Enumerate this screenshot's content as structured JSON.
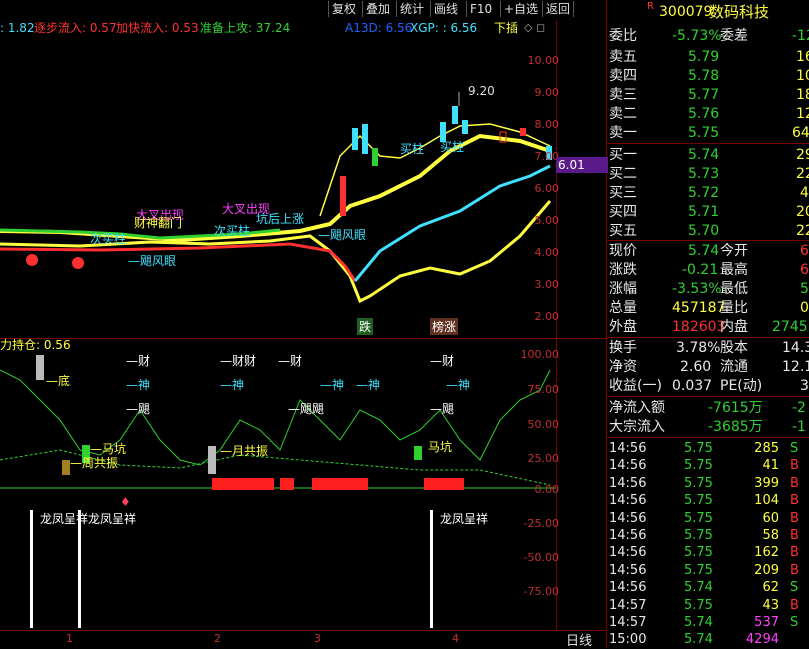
{
  "toolbar": {
    "buttons": [
      "复权",
      "叠加",
      "统计",
      "画线",
      "F10",
      "+自选",
      "返回"
    ]
  },
  "header": {
    "flag": "R",
    "code": "300079",
    "name": "数码科技"
  },
  "indicator_line": {
    "prefix": ": 1.82",
    "zhubu_label": "逐步流入: 0.57",
    "jiakuai_label": "加快流入: 0.53",
    "zhunbei_label": "准备上攻: 37.24",
    "a13d_label": "A13D: 6.56",
    "xgp_label": "XGP: : 6.56",
    "xiacha_label": "下插"
  },
  "upper_axis": [
    "10.00",
    "9.00",
    "8.00",
    "7.00",
    "6.00",
    "5.00",
    "4.00",
    "3.00",
    "2.00",
    "1.00"
  ],
  "price_marker": "6.01",
  "lower_axis": [
    "100.00",
    "75.00",
    "50.00",
    "25.00",
    "0.00",
    "-25.00",
    "-50.00",
    "-75.00"
  ],
  "lower_title": "力持仓: 0.56",
  "x_labels": [
    "1",
    "2",
    "3",
    "4"
  ],
  "period_button": "日线",
  "annotations": {
    "high": "9.20",
    "dachu1": "大叉出现",
    "dachu2": "大叉出现",
    "caishen": "财神翻门",
    "fengyan1": "—飓风眼",
    "fengyan2": "—飓风眼",
    "maizhu1": "次买柱",
    "maizhu2": "次买柱",
    "maizhu3": "买柱",
    "maizhu4": "买柱",
    "kenghou": "坑后上涨",
    "die": "跌",
    "zhang": "榜涨",
    "di": "—底",
    "cai1": "—财",
    "cai2": "—财财",
    "cai3": "—财",
    "cai4": "—财",
    "shen1": "—神",
    "shen2": "—神",
    "shen3": "—神",
    "shen4": "—神",
    "shen5": "—神",
    "hao1": "—飓",
    "hao2": "—飓飓",
    "hao3": "—飓",
    "makeng1": "—马坑",
    "makeng2": "马坑",
    "zhouzhen": "—周共振",
    "yuezhen": "—月共振",
    "longfeng1": "龙凤呈祥龙凤呈祥",
    "longfeng2": "龙凤呈祥"
  },
  "quote": {
    "weibi_label": "委比",
    "weibi_val": "-5.73%",
    "weicha_label": "委差",
    "weicha_val": "-12",
    "sell": [
      {
        "label": "卖五",
        "price": "5.79",
        "vol": "16"
      },
      {
        "label": "卖四",
        "price": "5.78",
        "vol": "10"
      },
      {
        "label": "卖三",
        "price": "5.77",
        "vol": "18"
      },
      {
        "label": "卖二",
        "price": "5.76",
        "vol": "12"
      },
      {
        "label": "卖一",
        "price": "5.75",
        "vol": "64"
      }
    ],
    "buy": [
      {
        "label": "买一",
        "price": "5.74",
        "vol": "29"
      },
      {
        "label": "买二",
        "price": "5.73",
        "vol": "22"
      },
      {
        "label": "买三",
        "price": "5.72",
        "vol": "4"
      },
      {
        "label": "买四",
        "price": "5.71",
        "vol": "20"
      },
      {
        "label": "买五",
        "price": "5.70",
        "vol": "22"
      }
    ],
    "stats": [
      {
        "l1": "现价",
        "v1": "5.74",
        "l2": "今开",
        "v2": "6"
      },
      {
        "l1": "涨跌",
        "v1": "-0.21",
        "l2": "最高",
        "v2": "6"
      },
      {
        "l1": "涨幅",
        "v1": "-3.53%",
        "l2": "最低",
        "v2": "5"
      },
      {
        "l1": "总量",
        "v1": "457187",
        "l2": "量比",
        "v2": "0"
      },
      {
        "l1": "外盘",
        "v1": "182603",
        "l2": "内盘",
        "v2": "2745"
      }
    ],
    "stats2": [
      {
        "l1": "换手",
        "v1": "3.78%",
        "l2": "股本",
        "v2": "14.3"
      },
      {
        "l1": "净资",
        "v1": "2.60",
        "l2": "流通",
        "v2": "12.1"
      },
      {
        "l1": "收益(一)",
        "v1": "0.037",
        "l2": "PE(动)",
        "v2": "3"
      }
    ],
    "flows": [
      {
        "l": "净流入额",
        "v": "-7615万",
        "v2": "-2"
      },
      {
        "l": "大宗流入",
        "v": "-3685万",
        "v2": "-1"
      }
    ]
  },
  "ticks": [
    {
      "t": "14:56",
      "p": "5.75",
      "v": "285",
      "s": "S"
    },
    {
      "t": "14:56",
      "p": "5.75",
      "v": "41",
      "s": "B"
    },
    {
      "t": "14:56",
      "p": "5.75",
      "v": "399",
      "s": "B"
    },
    {
      "t": "14:56",
      "p": "5.75",
      "v": "104",
      "s": "B"
    },
    {
      "t": "14:56",
      "p": "5.75",
      "v": "60",
      "s": "B"
    },
    {
      "t": "14:56",
      "p": "5.75",
      "v": "58",
      "s": "B"
    },
    {
      "t": "14:56",
      "p": "5.75",
      "v": "162",
      "s": "B"
    },
    {
      "t": "14:56",
      "p": "5.75",
      "v": "209",
      "s": "B"
    },
    {
      "t": "14:56",
      "p": "5.74",
      "v": "62",
      "s": "S"
    },
    {
      "t": "14:57",
      "p": "5.75",
      "v": "43",
      "s": "B"
    },
    {
      "t": "14:57",
      "p": "5.74",
      "v": "537",
      "s": "S"
    },
    {
      "t": "15:00",
      "p": "5.74",
      "v": "4294",
      "s": ""
    }
  ],
  "colors": {
    "red": "#ff3030",
    "green": "#30d030",
    "yellow": "#ffff40",
    "cyan": "#40e0ff",
    "magenta": "#ff40ff"
  }
}
